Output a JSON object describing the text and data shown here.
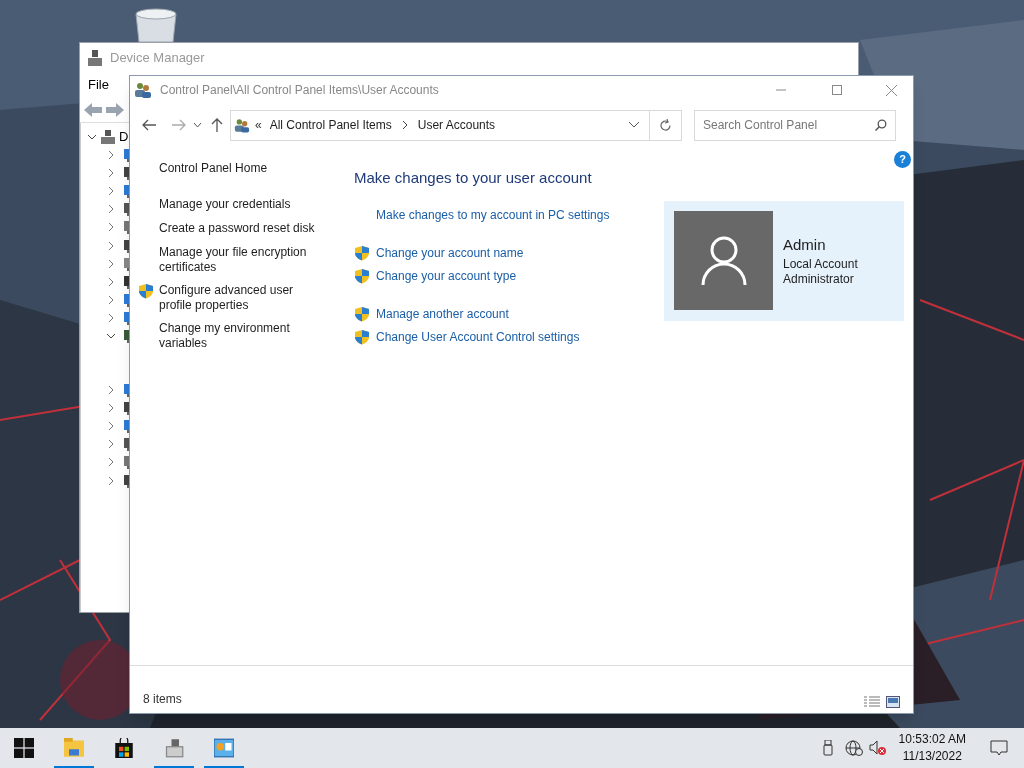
{
  "device_manager": {
    "title": "Device Manager",
    "menu": [
      "File"
    ],
    "tree": {
      "label": "D",
      "expanded": true,
      "children": [
        {
          "expanded": false
        },
        {
          "expanded": false
        },
        {
          "expanded": false
        },
        {
          "expanded": false
        },
        {
          "expanded": false
        },
        {
          "expanded": false
        },
        {
          "expanded": false
        },
        {
          "expanded": false
        },
        {
          "expanded": false
        },
        {
          "expanded": false
        },
        {
          "expanded": true
        },
        {
          "expanded": false
        },
        {
          "expanded": false
        },
        {
          "expanded": false
        },
        {
          "expanded": false
        },
        {
          "expanded": false
        },
        {
          "expanded": false
        }
      ]
    }
  },
  "control_panel": {
    "title": "Control Panel\\All Control Panel Items\\User Accounts",
    "address": {
      "prefix": "«",
      "crumbs": [
        "All Control Panel Items",
        "User Accounts"
      ]
    },
    "search": {
      "placeholder": "Search Control Panel"
    },
    "help": "?",
    "sidebar": {
      "home": "Control Panel Home",
      "links": [
        {
          "label": "Manage your credentials",
          "shield": false
        },
        {
          "label": "Create a password reset disk",
          "shield": false
        },
        {
          "label": "Manage your file encryption certificates",
          "shield": false
        },
        {
          "label": "Configure advanced user profile properties",
          "shield": true
        },
        {
          "label": "Change my environment variables",
          "shield": false
        }
      ]
    },
    "heading": "Make changes to your user account",
    "action_groups": [
      [
        {
          "label": "Make changes to my account in PC settings",
          "shield": false
        }
      ],
      [
        {
          "label": "Change your account name",
          "shield": true
        },
        {
          "label": "Change your account type",
          "shield": true
        }
      ],
      [
        {
          "label": "Manage another account",
          "shield": true
        },
        {
          "label": "Change User Account Control settings",
          "shield": true
        }
      ]
    ],
    "account": {
      "name": "Admin",
      "lines": [
        "Local Account",
        "Administrator"
      ]
    },
    "status_bar": {
      "count": "8 items"
    }
  },
  "taskbar": {
    "apps": [
      {
        "kind": "start",
        "running": false
      },
      {
        "kind": "explorer",
        "running": true
      },
      {
        "kind": "store",
        "running": false
      },
      {
        "kind": "device-manager",
        "running": true
      },
      {
        "kind": "control-panel",
        "running": true
      }
    ],
    "clock": {
      "time": "10:53:02 AM",
      "date": "11/13/2022"
    }
  }
}
